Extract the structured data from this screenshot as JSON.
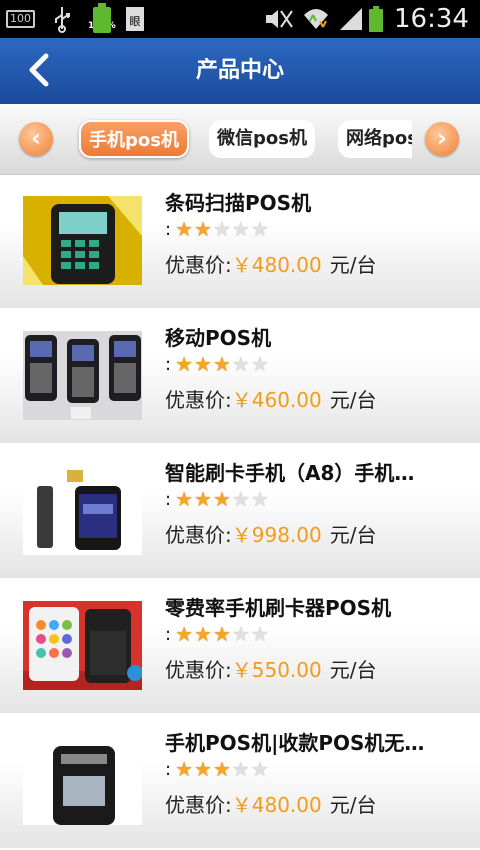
{
  "status_bar": {
    "left_box": "100",
    "battery_percent": "100%",
    "time": "16:34"
  },
  "header": {
    "title": "产品中心"
  },
  "tabs": [
    {
      "label": "手机pos机",
      "active": true
    },
    {
      "label": "微信pos机",
      "active": false
    },
    {
      "label": "网络pos机",
      "active": false
    }
  ],
  "products": [
    {
      "name": "条码扫描POS机",
      "rating_sep": ":",
      "stars": 2,
      "price_label": "优惠价:",
      "price": "￥480.00",
      "unit": "元/台"
    },
    {
      "name": "移动POS机",
      "rating_sep": ":",
      "stars": 3,
      "price_label": "优惠价:",
      "price": "￥460.00",
      "unit": "元/台"
    },
    {
      "name": "智能刷卡手机（A8）手机…",
      "rating_sep": ":",
      "stars": 3,
      "price_label": "优惠价:",
      "price": "￥998.00",
      "unit": "元/台"
    },
    {
      "name": "零费率手机刷卡器POS机",
      "rating_sep": ":",
      "stars": 3,
      "price_label": "优惠价:",
      "price": "￥550.00",
      "unit": "元/台"
    },
    {
      "name": "手机POS机|收款POS机无…",
      "rating_sep": ":",
      "stars": 3,
      "price_label": "优惠价:",
      "price": "￥480.00",
      "unit": "元/台"
    }
  ]
}
